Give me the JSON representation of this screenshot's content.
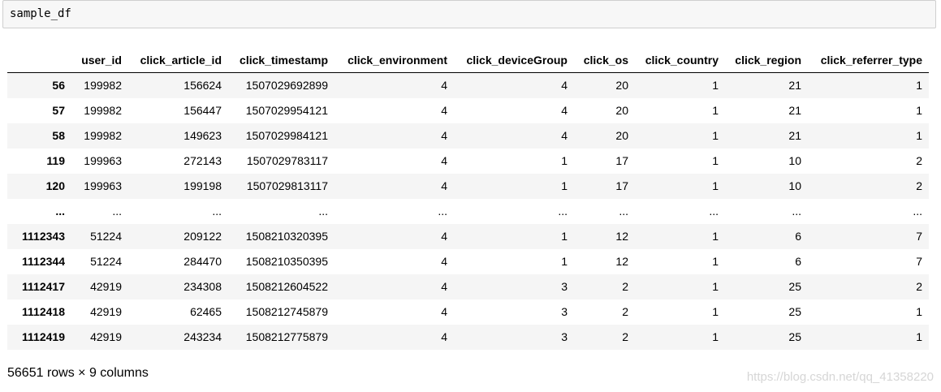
{
  "input": {
    "code": "sample_df"
  },
  "table": {
    "columns": [
      "",
      "user_id",
      "click_article_id",
      "click_timestamp",
      "click_environment",
      "click_deviceGroup",
      "click_os",
      "click_country",
      "click_region",
      "click_referrer_type"
    ],
    "rows": [
      [
        "56",
        "199982",
        "156624",
        "1507029692899",
        "4",
        "4",
        "20",
        "1",
        "21",
        "1"
      ],
      [
        "57",
        "199982",
        "156447",
        "1507029954121",
        "4",
        "4",
        "20",
        "1",
        "21",
        "1"
      ],
      [
        "58",
        "199982",
        "149623",
        "1507029984121",
        "4",
        "4",
        "20",
        "1",
        "21",
        "1"
      ],
      [
        "119",
        "199963",
        "272143",
        "1507029783117",
        "4",
        "1",
        "17",
        "1",
        "10",
        "2"
      ],
      [
        "120",
        "199963",
        "199198",
        "1507029813117",
        "4",
        "1",
        "17",
        "1",
        "10",
        "2"
      ],
      [
        "...",
        "...",
        "...",
        "...",
        "...",
        "...",
        "...",
        "...",
        "...",
        "..."
      ],
      [
        "1112343",
        "51224",
        "209122",
        "1508210320395",
        "4",
        "1",
        "12",
        "1",
        "6",
        "7"
      ],
      [
        "1112344",
        "51224",
        "284470",
        "1508210350395",
        "4",
        "1",
        "12",
        "1",
        "6",
        "7"
      ],
      [
        "1112417",
        "42919",
        "234308",
        "1508212604522",
        "4",
        "3",
        "2",
        "1",
        "25",
        "2"
      ],
      [
        "1112418",
        "42919",
        "62465",
        "1508212745879",
        "4",
        "3",
        "2",
        "1",
        "25",
        "1"
      ],
      [
        "1112419",
        "42919",
        "243234",
        "1508212775879",
        "4",
        "3",
        "2",
        "1",
        "25",
        "1"
      ]
    ]
  },
  "footer": {
    "shape": "56651 rows × 9 columns"
  },
  "watermark": {
    "text": "https://blog.csdn.net/qq_41358220"
  }
}
